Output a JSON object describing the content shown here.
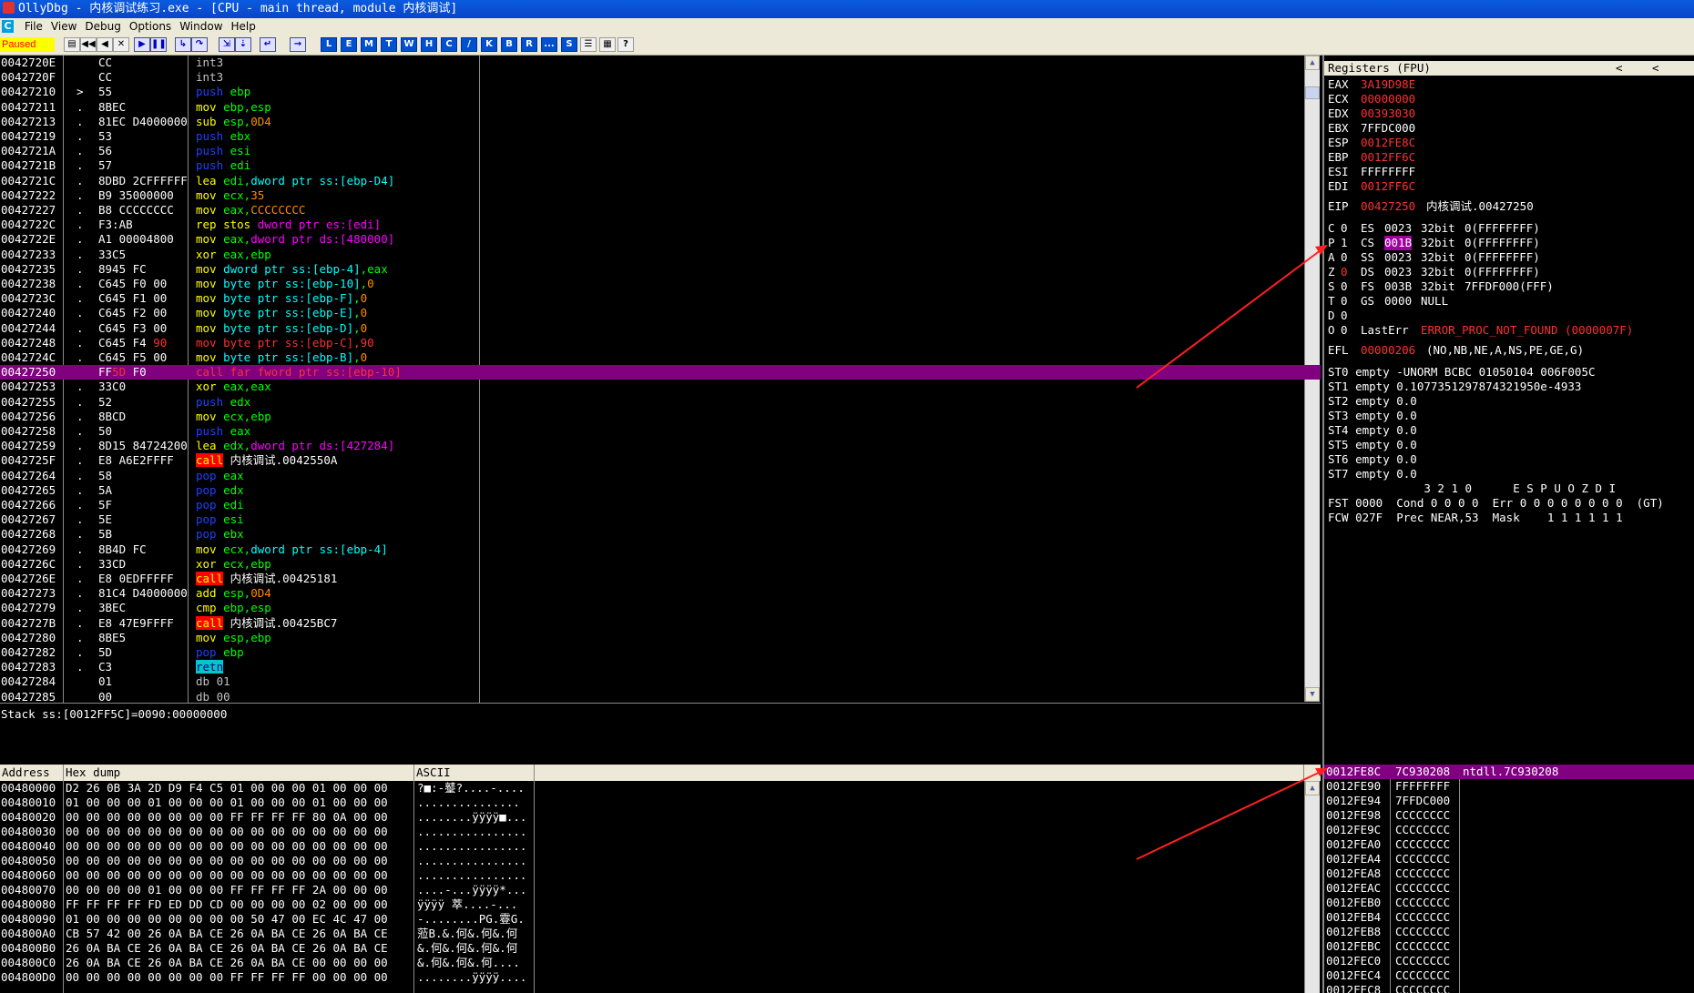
{
  "window": {
    "title": "OllyDbg - 内核调试练习.exe - [CPU - main thread, module 内核调试]"
  },
  "menu": [
    "File",
    "View",
    "Debug",
    "Options",
    "Window",
    "Help"
  ],
  "toolbar": {
    "status": "Paused",
    "buttons": [
      {
        "name": "open-icon",
        "g": "▤"
      },
      {
        "name": "restart-icon",
        "g": "◀◀"
      },
      {
        "name": "rewind-icon",
        "g": "◀"
      },
      {
        "name": "close-icon",
        "g": "✕"
      },
      {
        "name": "run-icon",
        "g": "▶"
      },
      {
        "name": "pause-icon",
        "g": "❚❚"
      },
      {
        "name": "step-into-icon",
        "g": "↳"
      },
      {
        "name": "step-over-icon",
        "g": "↷"
      },
      {
        "name": "trace-into-icon",
        "g": "⇲"
      },
      {
        "name": "trace-over-icon",
        "g": "⇣"
      },
      {
        "name": "execute-till-return-icon",
        "g": "↵"
      },
      {
        "name": "goto-icon",
        "g": "→"
      },
      {
        "name": "log-window",
        "g": "L"
      },
      {
        "name": "modules-window",
        "g": "E"
      },
      {
        "name": "memory-window",
        "g": "M"
      },
      {
        "name": "threads-window",
        "g": "T"
      },
      {
        "name": "windows-window",
        "g": "W"
      },
      {
        "name": "handles-window",
        "g": "H"
      },
      {
        "name": "cpu-window",
        "g": "C"
      },
      {
        "name": "patches-window",
        "g": "/"
      },
      {
        "name": "callstack-window",
        "g": "K"
      },
      {
        "name": "breakpoints-window",
        "g": "B"
      },
      {
        "name": "references-window",
        "g": "R"
      },
      {
        "name": "runtrace-window",
        "g": "..."
      },
      {
        "name": "source-window",
        "g": "S"
      },
      {
        "name": "list-icon",
        "g": "☰"
      },
      {
        "name": "grid-icon",
        "g": "▦"
      },
      {
        "name": "help-icon",
        "g": "?"
      }
    ]
  },
  "colors": {
    "highlight": "#800080",
    "background": "#000000",
    "panel": "#ECE9D8",
    "title_bar": "#0A54D8"
  },
  "disasm": [
    {
      "addr": "0042720E",
      "mk": "",
      "hex": "CC",
      "t": [
        [
          "int3",
          "gray"
        ]
      ]
    },
    {
      "addr": "0042720F",
      "mk": "",
      "hex": "CC",
      "t": [
        [
          "int3",
          "gray"
        ]
      ]
    },
    {
      "addr": "00427210",
      "mk": ">",
      "hex": "55",
      "t": [
        [
          "push ",
          "bl"
        ],
        [
          "ebp",
          "g"
        ]
      ]
    },
    {
      "addr": "00427211",
      "mk": ".",
      "hex": "8BEC",
      "t": [
        [
          "mov ",
          "y"
        ],
        [
          "ebp,esp",
          "g"
        ]
      ]
    },
    {
      "addr": "00427213",
      "mk": ".",
      "hex": "81EC D4000000",
      "t": [
        [
          "sub ",
          "y"
        ],
        [
          "esp,",
          "g"
        ],
        [
          "0D4",
          "o"
        ]
      ]
    },
    {
      "addr": "00427219",
      "mk": ".",
      "hex": "53",
      "t": [
        [
          "push ",
          "bl"
        ],
        [
          "ebx",
          "g"
        ]
      ]
    },
    {
      "addr": "0042721A",
      "mk": ".",
      "hex": "56",
      "t": [
        [
          "push ",
          "bl"
        ],
        [
          "esi",
          "g"
        ]
      ]
    },
    {
      "addr": "0042721B",
      "mk": ".",
      "hex": "57",
      "t": [
        [
          "push ",
          "bl"
        ],
        [
          "edi",
          "g"
        ]
      ]
    },
    {
      "addr": "0042721C",
      "mk": ".",
      "hex": "8DBD 2CFFFFFF",
      "t": [
        [
          "lea ",
          "y"
        ],
        [
          "edi,",
          "g"
        ],
        [
          "dword ptr ss:[ebp-D4]",
          "c"
        ]
      ]
    },
    {
      "addr": "00427222",
      "mk": ".",
      "hex": "B9 35000000",
      "t": [
        [
          "mov ",
          "y"
        ],
        [
          "ecx,",
          "g"
        ],
        [
          "35",
          "o"
        ]
      ]
    },
    {
      "addr": "00427227",
      "mk": ".",
      "hex": "B8 CCCCCCCC",
      "t": [
        [
          "mov ",
          "y"
        ],
        [
          "eax,",
          "g"
        ],
        [
          "CCCCCCCC",
          "o"
        ]
      ]
    },
    {
      "addr": "0042722C",
      "mk": ".",
      "hex": "F3:AB",
      "t": [
        [
          "rep stos ",
          "y"
        ],
        [
          "dword ptr es:[edi]",
          "m"
        ]
      ]
    },
    {
      "addr": "0042722E",
      "mk": ".",
      "hex": "A1 00004800",
      "t": [
        [
          "mov ",
          "y"
        ],
        [
          "eax,",
          "g"
        ],
        [
          "dword ptr ds:[480000]",
          "m"
        ]
      ]
    },
    {
      "addr": "00427233",
      "mk": ".",
      "hex": "33C5",
      "t": [
        [
          "xor ",
          "y"
        ],
        [
          "eax,ebp",
          "g"
        ]
      ]
    },
    {
      "addr": "00427235",
      "mk": ".",
      "hex": "8945 FC",
      "t": [
        [
          "mov ",
          "y"
        ],
        [
          "dword ptr ss:[ebp-4]",
          "c"
        ],
        [
          ",eax",
          "g"
        ]
      ]
    },
    {
      "addr": "00427238",
      "mk": ".",
      "hex": "C645 F0 00",
      "t": [
        [
          "mov ",
          "y"
        ],
        [
          "byte ptr ss:[ebp-10]",
          "c"
        ],
        [
          ",",
          "g"
        ],
        [
          "0",
          "o"
        ]
      ]
    },
    {
      "addr": "0042723C",
      "mk": ".",
      "hex": "C645 F1 00",
      "t": [
        [
          "mov ",
          "y"
        ],
        [
          "byte ptr ss:[ebp-F]",
          "c"
        ],
        [
          ",",
          "g"
        ],
        [
          "0",
          "o"
        ]
      ]
    },
    {
      "addr": "00427240",
      "mk": ".",
      "hex": "C645 F2 00",
      "t": [
        [
          "mov ",
          "y"
        ],
        [
          "byte ptr ss:[ebp-E]",
          "c"
        ],
        [
          ",",
          "g"
        ],
        [
          "0",
          "o"
        ]
      ]
    },
    {
      "addr": "00427244",
      "mk": ".",
      "hex": "C645 F3 00",
      "t": [
        [
          "mov ",
          "y"
        ],
        [
          "byte ptr ss:[ebp-D]",
          "c"
        ],
        [
          ",",
          "g"
        ],
        [
          "0",
          "o"
        ]
      ]
    },
    {
      "addr": "00427248",
      "mk": ".",
      "hex": "C645 F4 ",
      "hexr": "90",
      "t": [
        [
          "mov byte ptr ss:[ebp-C],90",
          "r"
        ]
      ]
    },
    {
      "addr": "0042724C",
      "mk": ".",
      "hex": "C645 F5 00",
      "t": [
        [
          "mov ",
          "y"
        ],
        [
          "byte ptr ss:[ebp-B]",
          "c"
        ],
        [
          ",",
          "g"
        ],
        [
          "0",
          "o"
        ]
      ]
    },
    {
      "addr": "00427250",
      "mk": "",
      "hex": "FF",
      "hexr": "5D",
      "hex2": " F0",
      "hl": true,
      "t": [
        [
          "call far fword ptr ss:[ebp-10]",
          "r"
        ]
      ]
    },
    {
      "addr": "00427253",
      "mk": ".",
      "hex": "33C0",
      "t": [
        [
          "xor ",
          "y"
        ],
        [
          "eax,eax",
          "g"
        ]
      ]
    },
    {
      "addr": "00427255",
      "mk": ".",
      "hex": "52",
      "t": [
        [
          "push ",
          "bl"
        ],
        [
          "edx",
          "g"
        ]
      ]
    },
    {
      "addr": "00427256",
      "mk": ".",
      "hex": "8BCD",
      "t": [
        [
          "mov ",
          "y"
        ],
        [
          "ecx,ebp",
          "g"
        ]
      ]
    },
    {
      "addr": "00427258",
      "mk": ".",
      "hex": "50",
      "t": [
        [
          "push ",
          "bl"
        ],
        [
          "eax",
          "g"
        ]
      ]
    },
    {
      "addr": "00427259",
      "mk": ".",
      "hex": "8D15 84724200",
      "t": [
        [
          "lea ",
          "y"
        ],
        [
          "edx,",
          "g"
        ],
        [
          "dword ptr ds:[427284]",
          "m"
        ]
      ]
    },
    {
      "addr": "0042725F",
      "mk": ".",
      "hex": "E8 A6E2FFFF",
      "t": [
        [
          "call",
          "bgr"
        ],
        [
          " 内核调试.0042550A",
          "w"
        ]
      ]
    },
    {
      "addr": "00427264",
      "mk": ".",
      "hex": "58",
      "t": [
        [
          "pop ",
          "bl"
        ],
        [
          "eax",
          "g"
        ]
      ]
    },
    {
      "addr": "00427265",
      "mk": ".",
      "hex": "5A",
      "t": [
        [
          "pop ",
          "bl"
        ],
        [
          "edx",
          "g"
        ]
      ]
    },
    {
      "addr": "00427266",
      "mk": ".",
      "hex": "5F",
      "t": [
        [
          "pop ",
          "bl"
        ],
        [
          "edi",
          "g"
        ]
      ]
    },
    {
      "addr": "00427267",
      "mk": ".",
      "hex": "5E",
      "t": [
        [
          "pop ",
          "bl"
        ],
        [
          "esi",
          "g"
        ]
      ]
    },
    {
      "addr": "00427268",
      "mk": ".",
      "hex": "5B",
      "t": [
        [
          "pop ",
          "bl"
        ],
        [
          "ebx",
          "g"
        ]
      ]
    },
    {
      "addr": "00427269",
      "mk": ".",
      "hex": "8B4D FC",
      "t": [
        [
          "mov ",
          "y"
        ],
        [
          "ecx,",
          "g"
        ],
        [
          "dword ptr ss:[ebp-4]",
          "c"
        ]
      ]
    },
    {
      "addr": "0042726C",
      "mk": ".",
      "hex": "33CD",
      "t": [
        [
          "xor ",
          "y"
        ],
        [
          "ecx,ebp",
          "g"
        ]
      ]
    },
    {
      "addr": "0042726E",
      "mk": ".",
      "hex": "E8 0EDFFFFF",
      "t": [
        [
          "call",
          "bgr"
        ],
        [
          " 内核调试.00425181",
          "w"
        ]
      ]
    },
    {
      "addr": "00427273",
      "mk": ".",
      "hex": "81C4 D4000000",
      "t": [
        [
          "add ",
          "y"
        ],
        [
          "esp,",
          "g"
        ],
        [
          "0D4",
          "o"
        ]
      ]
    },
    {
      "addr": "00427279",
      "mk": ".",
      "hex": "3BEC",
      "t": [
        [
          "cmp ",
          "y"
        ],
        [
          "ebp,esp",
          "g"
        ]
      ]
    },
    {
      "addr": "0042727B",
      "mk": ".",
      "hex": "E8 47E9FFFF",
      "t": [
        [
          "call",
          "bgr"
        ],
        [
          " 内核调试.00425BC7",
          "w"
        ]
      ]
    },
    {
      "addr": "00427280",
      "mk": ".",
      "hex": "8BE5",
      "t": [
        [
          "mov ",
          "y"
        ],
        [
          "esp,ebp",
          "g"
        ]
      ]
    },
    {
      "addr": "00427282",
      "mk": ".",
      "hex": "5D",
      "t": [
        [
          "pop ",
          "bl"
        ],
        [
          "ebp",
          "g"
        ]
      ]
    },
    {
      "addr": "00427283",
      "mk": ".",
      "hex": "C3",
      "t": [
        [
          "retn",
          "bgc"
        ]
      ]
    },
    {
      "addr": "00427284",
      "mk": "",
      "hex": "01",
      "t": [
        [
          "db 01",
          "gray"
        ]
      ]
    },
    {
      "addr": "00427285",
      "mk": "",
      "hex": "00",
      "t": [
        [
          "db 00",
          "gray"
        ]
      ]
    }
  ],
  "info": {
    "text": "Stack ss:[0012FF5C]=0090:00000000"
  },
  "registers": {
    "header": "Registers (FPU)",
    "gp": [
      [
        "EAX",
        "3A19D98E",
        "r"
      ],
      [
        "ECX",
        "00000000",
        "r"
      ],
      [
        "EDX",
        "00393030",
        "r"
      ],
      [
        "EBX",
        "7FFDC000",
        "w"
      ],
      [
        "ESP",
        "0012FE8C",
        "r"
      ],
      [
        "EBP",
        "0012FF6C",
        "r"
      ],
      [
        "ESI",
        "FFFFFFFF",
        "w"
      ],
      [
        "EDI",
        "0012FF6C",
        "r"
      ]
    ],
    "eip": {
      "label": "EIP",
      "value": "00427250",
      "comment": "内核调试.00427250"
    },
    "flags": [
      {
        "f": "C",
        "v": "0",
        "seg": "ES",
        "sel": "0023",
        "bits": "32bit",
        "base": "0(FFFFFFFF)"
      },
      {
        "f": "P",
        "v": "1",
        "seg": "CS",
        "sel": "001B",
        "bits": "32bit",
        "base": "0(FFFFFFFF)",
        "selhl": true
      },
      {
        "f": "A",
        "v": "0",
        "seg": "SS",
        "sel": "0023",
        "bits": "32bit",
        "base": "0(FFFFFFFF)"
      },
      {
        "f": "Z",
        "v": "0",
        "vr": true,
        "seg": "DS",
        "sel": "0023",
        "bits": "32bit",
        "base": "0(FFFFFFFF)"
      },
      {
        "f": "S",
        "v": "0",
        "seg": "FS",
        "sel": "003B",
        "bits": "32bit",
        "base": "7FFDF000(FFF)"
      },
      {
        "f": "T",
        "v": "0",
        "seg": "GS",
        "sel": "0000",
        "bits": "NULL",
        "base": ""
      },
      {
        "f": "D",
        "v": "0",
        "seg": "",
        "sel": "",
        "bits": "",
        "base": ""
      },
      {
        "f": "O",
        "v": "0",
        "seg": "LastErr",
        "sel": "",
        "bits": "ERROR_PROC_NOT_FOUND (0000007F)",
        "base": "",
        "err": true
      }
    ],
    "efl": {
      "label": "EFL",
      "value": "00000206",
      "desc": "(NO,NB,NE,A,NS,PE,GE,G)"
    },
    "st": [
      "ST0 empty -UNORM BCBC 01050104 006F005C",
      "ST1 empty 0.1077351297874321950e-4933",
      "ST2 empty 0.0",
      "ST3 empty 0.0",
      "ST4 empty 0.0",
      "ST5 empty 0.0",
      "ST6 empty 0.0",
      "ST7 empty 0.0"
    ],
    "fpu_hdr": "              3 2 1 0      E S P U O Z D I",
    "fst": "FST 0000  Cond 0 0 0 0  Err 0 0 0 0 0 0 0 0  (GT)",
    "fcw": "FCW 027F  Prec NEAR,53  Mask    1 1 1 1 1 1"
  },
  "dump": {
    "headers": [
      "Address",
      "Hex dump",
      "ASCII"
    ],
    "rows": [
      [
        "00480000",
        "D2 26 0B 3A 2D D9 F4 C5 01 00 00 00 01 00 00 00",
        "?■:-鼞?....-...."
      ],
      [
        "00480010",
        "01 00 00 00 01 00 00 00 01 00 00 00 01 00 00 00",
        "..............."
      ],
      [
        "00480020",
        "00 00 00 00 00 00 00 00 FF FF FF FF 80 0A 00 00",
        "........ÿÿÿÿ■..."
      ],
      [
        "00480030",
        "00 00 00 00 00 00 00 00 00 00 00 00 00 00 00 00",
        "................"
      ],
      [
        "00480040",
        "00 00 00 00 00 00 00 00 00 00 00 00 00 00 00 00",
        "................"
      ],
      [
        "00480050",
        "00 00 00 00 00 00 00 00 00 00 00 00 00 00 00 00",
        "................"
      ],
      [
        "00480060",
        "00 00 00 00 00 00 00 00 00 00 00 00 00 00 00 00",
        "................"
      ],
      [
        "00480070",
        "00 00 00 00 01 00 00 00 FF FF FF FF 2A 00 00 00",
        "....-...ÿÿÿÿ*..."
      ],
      [
        "00480080",
        "FF FF FF FF FD ED DD CD 00 00 00 00 02 00 00 00",
        "ÿÿÿÿ  萃....-..."
      ],
      [
        "00480090",
        "01 00 00 00 00 00 00 00 00 50 47 00 EC 4C 47 00",
        "-........PG.霯G."
      ],
      [
        "004800A0",
        "CB 57 42 00 26 0A BA CE 26 0A BA CE 26 0A BA CE",
        "蒞B.&.何&.何&.何"
      ],
      [
        "004800B0",
        "26 0A BA CE 26 0A BA CE 26 0A BA CE 26 0A BA CE",
        "&.何&.何&.何&.何"
      ],
      [
        "004800C0",
        "26 0A BA CE 26 0A BA CE 26 0A BA CE 00 00 00 00",
        "&.何&.何&.何...."
      ],
      [
        "004800D0",
        "00 00 00 00 00 00 00 00 FF FF FF FF 00 00 00 00",
        "........ÿÿÿÿ...."
      ]
    ]
  },
  "stack": [
    [
      "0012FE8C",
      "7C930208",
      "ntdll.7C930208",
      true
    ],
    [
      "0012FE90",
      "FFFFFFFF",
      "",
      false
    ],
    [
      "0012FE94",
      "7FFDC000",
      "",
      false
    ],
    [
      "0012FE98",
      "CCCCCCCC",
      "",
      false
    ],
    [
      "0012FE9C",
      "CCCCCCCC",
      "",
      false
    ],
    [
      "0012FEA0",
      "CCCCCCCC",
      "",
      false
    ],
    [
      "0012FEA4",
      "CCCCCCCC",
      "",
      false
    ],
    [
      "0012FEA8",
      "CCCCCCCC",
      "",
      false
    ],
    [
      "0012FEAC",
      "CCCCCCCC",
      "",
      false
    ],
    [
      "0012FEB0",
      "CCCCCCCC",
      "",
      false
    ],
    [
      "0012FEB4",
      "CCCCCCCC",
      "",
      false
    ],
    [
      "0012FEB8",
      "CCCCCCCC",
      "",
      false
    ],
    [
      "0012FEBC",
      "CCCCCCCC",
      "",
      false
    ],
    [
      "0012FEC0",
      "CCCCCCCC",
      "",
      false
    ],
    [
      "0012FEC4",
      "CCCCCCCC",
      "",
      false
    ],
    [
      "0012FEC8",
      "CCCCCCCC",
      "",
      false
    ]
  ]
}
